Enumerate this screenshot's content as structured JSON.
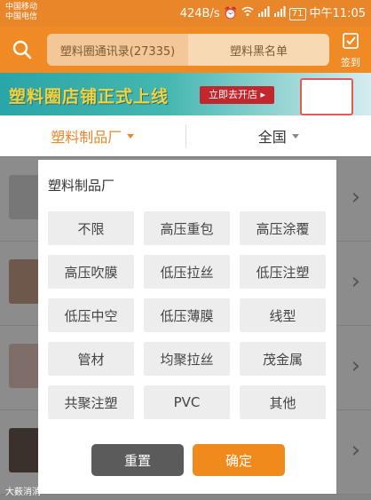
{
  "status_bar": {
    "carrier_1": "中国移动",
    "carrier_2": "中国电信",
    "speed": "424B/s",
    "battery": "71",
    "time": "中午11:05"
  },
  "header": {
    "tabs": [
      {
        "label": "塑料圈通讯录(27335)"
      },
      {
        "label": "塑料黑名单"
      }
    ],
    "signin_label": "签到"
  },
  "banner": {
    "title": "塑料圈店铺正式上线",
    "button": "立即去开店 ▸"
  },
  "filters": [
    {
      "label": "塑料制品厂",
      "active": true
    },
    {
      "label": "全国",
      "active": false
    }
  ],
  "dialog": {
    "title": "塑料制品厂",
    "options": [
      {
        "label": "不限"
      },
      {
        "label": "高压重包"
      },
      {
        "label": "高压涂覆"
      },
      {
        "label": "高压吹膜"
      },
      {
        "label": "低压拉丝"
      },
      {
        "label": "低压注塑"
      },
      {
        "label": "低压中空"
      },
      {
        "label": "低压薄膜"
      },
      {
        "label": "线型"
      },
      {
        "label": "管材"
      },
      {
        "label": "均聚拉丝"
      },
      {
        "label": "茂金属"
      },
      {
        "label": "共聚注塑"
      },
      {
        "label": "PVC"
      },
      {
        "label": "其他"
      }
    ],
    "reset_label": "重置",
    "confirm_label": "确定"
  },
  "watermark": "大薮消消",
  "colors": {
    "accent": "#f08a1c",
    "header": "#f08a24",
    "reset": "#5b5b5b"
  }
}
